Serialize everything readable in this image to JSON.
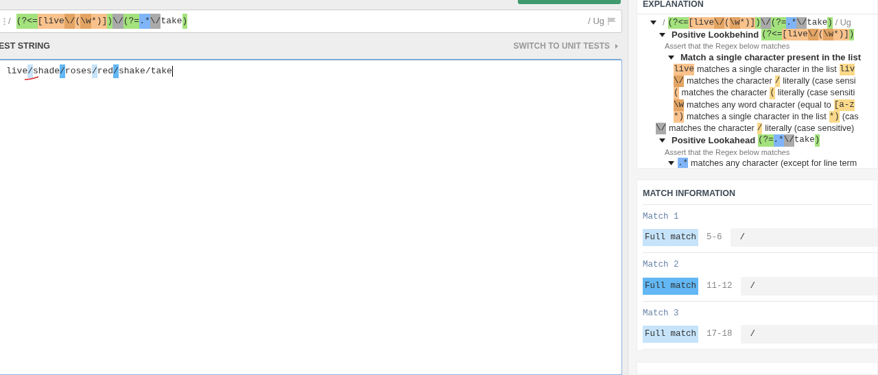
{
  "regex_bar": {
    "delimiter": "/",
    "tokens": [
      {
        "text": "(?<=",
        "kind": "group"
      },
      {
        "text": "[",
        "kind": "set"
      },
      {
        "text": "live",
        "kind": "set"
      },
      {
        "text": "\\/",
        "kind": "set_escape"
      },
      {
        "text": "(",
        "kind": "set"
      },
      {
        "text": "\\w",
        "kind": "set_escape"
      },
      {
        "text": "*)",
        "kind": "set"
      },
      {
        "text": "]",
        "kind": "set"
      },
      {
        "text": ")",
        "kind": "group"
      },
      {
        "text": "\\/",
        "kind": "escape"
      },
      {
        "text": "(?=",
        "kind": "group"
      },
      {
        "text": ".*",
        "kind": "meta"
      },
      {
        "text": "\\/",
        "kind": "escape"
      },
      {
        "text": "take",
        "kind": "plain"
      },
      {
        "text": ")",
        "kind": "group"
      }
    ],
    "flags": "/ Ug"
  },
  "test_string": {
    "title": "EST STRING",
    "switch_link": "SWITCH TO UNIT TESTS",
    "segments": [
      {
        "text": "live",
        "matched": false
      },
      {
        "text": "/",
        "matched": true,
        "alternate": false
      },
      {
        "text": "shade",
        "matched": false
      },
      {
        "text": "/",
        "matched": true,
        "alternate": true
      },
      {
        "text": "roses",
        "matched": false
      },
      {
        "text": "/",
        "matched": true,
        "alternate": false
      },
      {
        "text": "red",
        "matched": false
      },
      {
        "text": "/",
        "matched": true,
        "alternate": true
      },
      {
        "text": "shake/take",
        "matched": false
      }
    ]
  },
  "explanation": {
    "title": "EXPLANATION",
    "tree": [
      {
        "kind": "group",
        "expanded": true,
        "segments": [
          {
            "text": "/",
            "kind": "muted"
          },
          {
            "text": "(?<=",
            "kind": "group"
          },
          {
            "text": "[",
            "kind": "set"
          },
          {
            "text": "live",
            "kind": "set"
          },
          {
            "text": "\\/",
            "kind": "set_escape"
          },
          {
            "text": "(",
            "kind": "set"
          },
          {
            "text": "\\w",
            "kind": "set_escape"
          },
          {
            "text": "*)",
            "kind": "set"
          },
          {
            "text": "]",
            "kind": "set"
          },
          {
            "text": ")",
            "kind": "group"
          },
          {
            "text": "\\/",
            "kind": "escape"
          },
          {
            "text": "(?=",
            "kind": "group"
          },
          {
            "text": ".*",
            "kind": "meta"
          },
          {
            "text": "\\/",
            "kind": "escape"
          },
          {
            "text": "take",
            "kind": "plain"
          },
          {
            "text": ")",
            "kind": "group"
          },
          {
            "text": "/ Ug",
            "kind": "muted"
          }
        ],
        "children": [
          {
            "kind": "group",
            "expanded": true,
            "segments": [
              {
                "text": "Positive Lookbehind",
                "kind": "heading"
              },
              {
                "text": "(?<=",
                "kind": "group"
              },
              {
                "text": "[",
                "kind": "set"
              },
              {
                "text": "live",
                "kind": "set"
              },
              {
                "text": "\\/",
                "kind": "set_escape"
              },
              {
                "text": "(",
                "kind": "set"
              },
              {
                "text": "\\w",
                "kind": "set_escape"
              },
              {
                "text": "*)",
                "kind": "set"
              },
              {
                "text": "]",
                "kind": "set"
              },
              {
                "text": ")",
                "kind": "group"
              }
            ],
            "children": [
              {
                "kind": "note",
                "segments": [
                  {
                    "text": "Assert that the Regex below matches",
                    "kind": "note"
                  }
                ]
              },
              {
                "kind": "group",
                "expanded": true,
                "segments": [
                  {
                    "text": "Match a single character present in the list",
                    "kind": "heading"
                  }
                ],
                "children": [
                  {
                    "kind": "leaf",
                    "segments": [
                      {
                        "text": "live",
                        "kind": "set"
                      },
                      {
                        "text": "matches a single character in the list",
                        "kind": "text"
                      },
                      {
                        "text": "liv",
                        "kind": "literal"
                      }
                    ]
                  },
                  {
                    "kind": "leaf",
                    "segments": [
                      {
                        "text": "\\/",
                        "kind": "set_escape"
                      },
                      {
                        "text": "matches the character",
                        "kind": "text"
                      },
                      {
                        "text": "/",
                        "kind": "literal"
                      },
                      {
                        "text": "literally (case sensi",
                        "kind": "text"
                      }
                    ]
                  },
                  {
                    "kind": "leaf",
                    "segments": [
                      {
                        "text": "(",
                        "kind": "set"
                      },
                      {
                        "text": "matches the character",
                        "kind": "text"
                      },
                      {
                        "text": "(",
                        "kind": "literal"
                      },
                      {
                        "text": "literally (case sensiti",
                        "kind": "text"
                      }
                    ]
                  },
                  {
                    "kind": "leaf",
                    "segments": [
                      {
                        "text": "\\w",
                        "kind": "set_escape"
                      },
                      {
                        "text": "matches any word character (equal to",
                        "kind": "text"
                      },
                      {
                        "text": "[a-z",
                        "kind": "literal"
                      }
                    ]
                  },
                  {
                    "kind": "leaf",
                    "segments": [
                      {
                        "text": "*)",
                        "kind": "set"
                      },
                      {
                        "text": "matches a single character in the list",
                        "kind": "text"
                      },
                      {
                        "text": "*)",
                        "kind": "literal"
                      },
                      {
                        "text": "(cas",
                        "kind": "text"
                      }
                    ]
                  }
                ]
              }
            ]
          },
          {
            "kind": "leaf",
            "segments": [
              {
                "text": "\\/",
                "kind": "escape"
              },
              {
                "text": "matches the character",
                "kind": "text"
              },
              {
                "text": "/",
                "kind": "literal"
              },
              {
                "text": "literally (case sensitive)",
                "kind": "text"
              }
            ]
          },
          {
            "kind": "group",
            "expanded": true,
            "segments": [
              {
                "text": "Positive Lookahead",
                "kind": "heading"
              },
              {
                "text": "(?=",
                "kind": "group"
              },
              {
                "text": ".*",
                "kind": "meta"
              },
              {
                "text": "\\/",
                "kind": "escape"
              },
              {
                "text": "take",
                "kind": "plain"
              },
              {
                "text": ")",
                "kind": "group"
              }
            ],
            "children": [
              {
                "kind": "note",
                "segments": [
                  {
                    "text": "Assert that the Regex below matches",
                    "kind": "note"
                  }
                ]
              },
              {
                "kind": "group",
                "expanded": true,
                "segments": [
                  {
                    "text": ".*",
                    "kind": "meta"
                  },
                  {
                    "text": "matches any character (except for line term",
                    "kind": "text"
                  }
                ]
              }
            ]
          }
        ]
      }
    ]
  },
  "match_information": {
    "title": "MATCH INFORMATION",
    "matches": [
      {
        "title": "Match 1",
        "label": "Full match",
        "range": "5-6",
        "value": "/",
        "selected": false
      },
      {
        "title": "Match 2",
        "label": "Full match",
        "range": "11-12",
        "value": "/",
        "selected": true
      },
      {
        "title": "Match 3",
        "label": "Full match",
        "range": "17-18",
        "value": "/",
        "selected": false
      }
    ]
  }
}
